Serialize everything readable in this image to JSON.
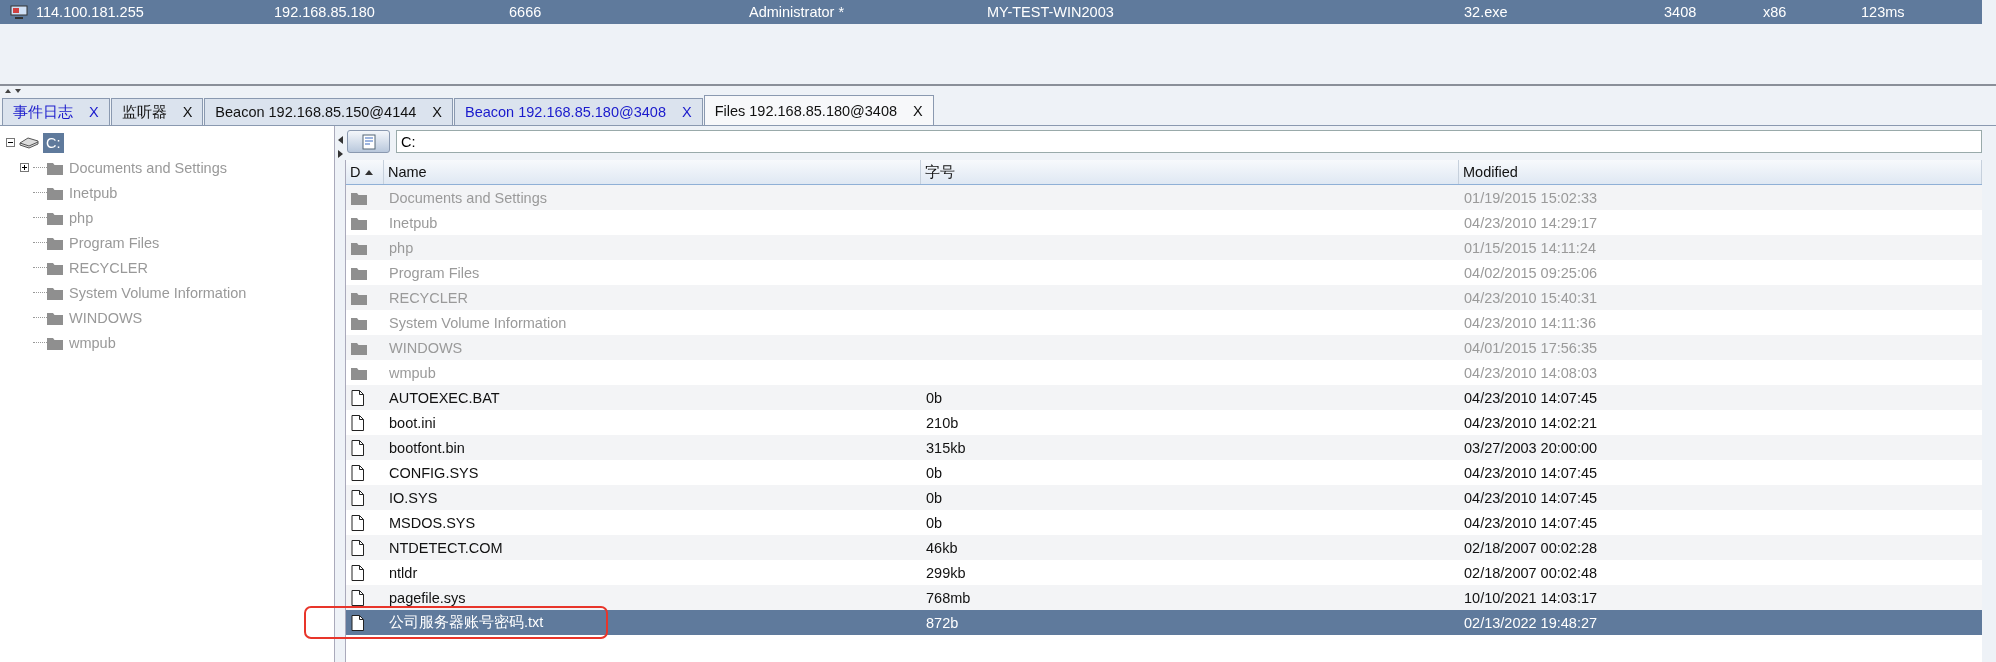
{
  "session": {
    "cells": [
      "114.100.181.255",
      "192.168.85.180",
      "6666",
      "Administrator *",
      "MY-TEST-WIN2003",
      "32.exe",
      "3408",
      "x86",
      "123ms"
    ]
  },
  "tabs": [
    {
      "label": "事件日志",
      "close": "X",
      "selected": false,
      "highlighted": true
    },
    {
      "label": "监听器",
      "close": "X",
      "selected": false,
      "highlighted": false
    },
    {
      "label": "Beacon 192.168.85.150@4144",
      "close": "X",
      "selected": false,
      "highlighted": false
    },
    {
      "label": "Beacon 192.168.85.180@3408",
      "close": "X",
      "selected": false,
      "highlighted": true
    },
    {
      "label": "Files 192.168.85.180@3408",
      "close": "X",
      "selected": true,
      "highlighted": false
    }
  ],
  "tree": {
    "root": {
      "label": "C:",
      "selected": true,
      "expanded": true,
      "children": [
        {
          "label": "Documents and Settings",
          "expandable": true
        },
        {
          "label": "Inetpub",
          "expandable": false
        },
        {
          "label": "php",
          "expandable": false
        },
        {
          "label": "Program Files",
          "expandable": false
        },
        {
          "label": "RECYCLER",
          "expandable": false
        },
        {
          "label": "System Volume Information",
          "expandable": false
        },
        {
          "label": "WINDOWS",
          "expandable": false
        },
        {
          "label": "wmpub",
          "expandable": false
        }
      ]
    }
  },
  "path": {
    "value": "C:"
  },
  "table": {
    "columns": [
      {
        "label": "D",
        "sorted": true
      },
      {
        "label": "Name",
        "sorted": false
      },
      {
        "label": "字号",
        "sorted": false
      },
      {
        "label": "Modified",
        "sorted": false
      }
    ],
    "rows": [
      {
        "kind": "folder",
        "name": "Documents and Settings",
        "modified": "01/19/2015 15:02:33",
        "selected": false,
        "annotated": false
      },
      {
        "kind": "folder",
        "name": "Inetpub",
        "modified": "04/23/2010 14:29:17",
        "selected": false,
        "annotated": false
      },
      {
        "kind": "folder",
        "name": "php",
        "modified": "01/15/2015 14:11:24",
        "selected": false,
        "annotated": false
      },
      {
        "kind": "folder",
        "name": "Program Files",
        "modified": "04/02/2015 09:25:06",
        "selected": false,
        "annotated": false
      },
      {
        "kind": "folder",
        "name": "RECYCLER",
        "modified": "04/23/2010 15:40:31",
        "selected": false,
        "annotated": false
      },
      {
        "kind": "folder",
        "name": "System Volume Information",
        "modified": "04/23/2010 14:11:36",
        "selected": false,
        "annotated": false
      },
      {
        "kind": "folder",
        "name": "WINDOWS",
        "modified": "04/01/2015 17:56:35",
        "selected": false,
        "annotated": false
      },
      {
        "kind": "folder",
        "name": "wmpub",
        "modified": "04/23/2010 14:08:03",
        "selected": false,
        "annotated": false
      },
      {
        "kind": "file",
        "name": "AUTOEXEC.BAT",
        "size": "0b",
        "modified": "04/23/2010 14:07:45",
        "selected": false,
        "annotated": false
      },
      {
        "kind": "file",
        "name": "boot.ini",
        "size": "210b",
        "modified": "04/23/2010 14:02:21",
        "selected": false,
        "annotated": false
      },
      {
        "kind": "file",
        "name": "bootfont.bin",
        "size": "315kb",
        "modified": "03/27/2003 20:00:00",
        "selected": false,
        "annotated": false
      },
      {
        "kind": "file",
        "name": "CONFIG.SYS",
        "size": "0b",
        "modified": "04/23/2010 14:07:45",
        "selected": false,
        "annotated": false
      },
      {
        "kind": "file",
        "name": "IO.SYS",
        "size": "0b",
        "modified": "04/23/2010 14:07:45",
        "selected": false,
        "annotated": false
      },
      {
        "kind": "file",
        "name": "MSDOS.SYS",
        "size": "0b",
        "modified": "04/23/2010 14:07:45",
        "selected": false,
        "annotated": false
      },
      {
        "kind": "file",
        "name": "NTDETECT.COM",
        "size": "46kb",
        "modified": "02/18/2007 00:02:28",
        "selected": false,
        "annotated": false
      },
      {
        "kind": "file",
        "name": "ntldr",
        "size": "299kb",
        "modified": "02/18/2007 00:02:48",
        "selected": false,
        "annotated": false
      },
      {
        "kind": "file",
        "name": "pagefile.sys",
        "size": "768mb",
        "modified": "10/10/2021 14:03:17",
        "selected": false,
        "annotated": false
      },
      {
        "kind": "file",
        "name": "公司服务器账号密码.txt",
        "size": "872b",
        "modified": "02/13/2022 19:48:27",
        "selected": true,
        "annotated": true
      }
    ]
  }
}
